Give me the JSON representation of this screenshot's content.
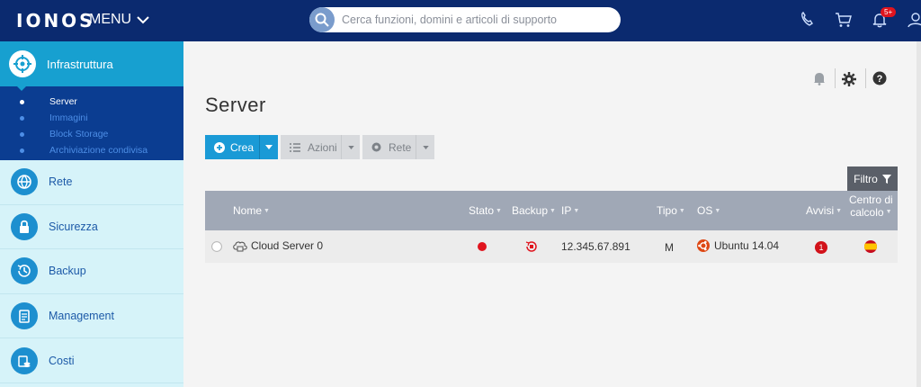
{
  "header": {
    "logo": "IONOS",
    "menu_label": "MENU",
    "search_placeholder": "Cerca funzioni, domini e articoli di supporto",
    "notifications_badge": "5+"
  },
  "sidebar": {
    "active_section": "Infrastruttura",
    "sub_items": [
      {
        "label": "Server",
        "active": true
      },
      {
        "label": "Immagini",
        "active": false
      },
      {
        "label": "Block Storage",
        "active": false
      },
      {
        "label": "Archiviazione condivisa",
        "active": false
      }
    ],
    "items": [
      {
        "label": "Rete",
        "icon": "globe-icon"
      },
      {
        "label": "Sicurezza",
        "icon": "lock-icon"
      },
      {
        "label": "Backup",
        "icon": "history-icon"
      },
      {
        "label": "Management",
        "icon": "clipboard-icon"
      },
      {
        "label": "Costi",
        "icon": "coins-icon"
      }
    ]
  },
  "page": {
    "title": "Server"
  },
  "toolbar": {
    "create_label": "Crea",
    "actions_label": "Azioni",
    "network_label": "Rete",
    "filter_label": "Filtro"
  },
  "table": {
    "columns": {
      "name": "Nome",
      "state": "Stato",
      "backup": "Backup",
      "ip": "IP",
      "type": "Tipo",
      "os": "OS",
      "alerts": "Avvisi",
      "datacenter_line1": "Centro di",
      "datacenter_line2": "calcolo"
    },
    "rows": [
      {
        "name": "Cloud Server 0",
        "state_color": "#e0141e",
        "ip": "12.345.67.891",
        "type": "M",
        "os": "Ubuntu 14.04",
        "alerts": "1",
        "datacenter_flag": "spain-flag-icon"
      }
    ]
  },
  "colors": {
    "topbar": "#0b2a6f",
    "accent": "#17a0d0",
    "sidebar_bg": "#d6f3f9",
    "status_red": "#e0141e",
    "ubuntu": "#dd4814"
  }
}
